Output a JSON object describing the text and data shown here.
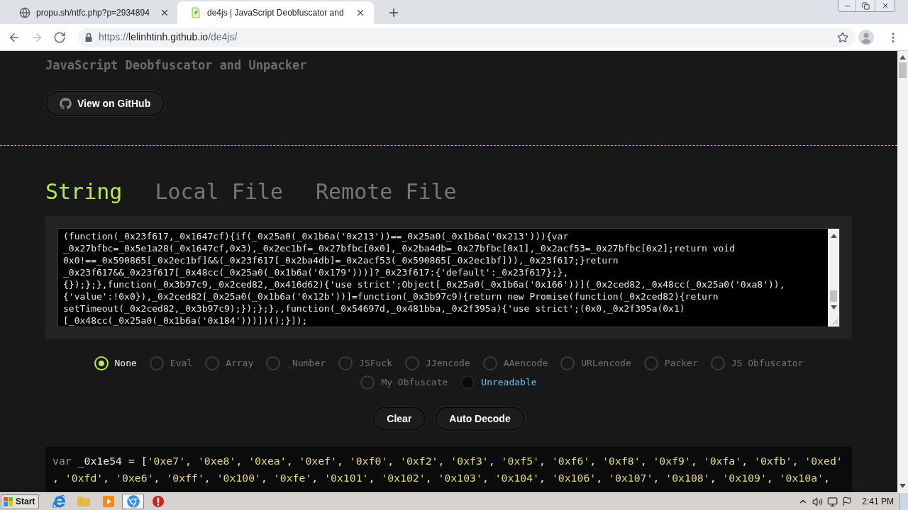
{
  "browser": {
    "tabs": [
      {
        "kind": "globe",
        "title": "propu.sh/ntfc.php?p=2934894",
        "selected": false
      },
      {
        "kind": "document",
        "title": "de4js | JavaScript Deobfuscator and",
        "selected": true
      }
    ],
    "nav": [
      {
        "kind": "back",
        "disabled": false
      },
      {
        "kind": "forward",
        "disabled": true
      },
      {
        "kind": "reload",
        "disabled": false
      }
    ],
    "address": {
      "scheme": "https://",
      "host": "lelinhtinh.github.io",
      "path": "/de4js/"
    }
  },
  "page": {
    "subtitle": "JavaScript Deobfuscator and Unpacker",
    "github_button": "View on GitHub",
    "tabs": [
      {
        "label": "String",
        "selected": true
      },
      {
        "label": "Local File",
        "selected": false
      },
      {
        "label": "Remote File",
        "selected": false
      }
    ],
    "input": {
      "lines": [
        "(function(_0x23f617,_0x1647cf){if(_0x25a0(_0x1b6a('0x213'))==_0x25a0(_0x1b6a('0x213'))){var",
        "_0x27bfbc=_0x5e1a28(_0x1647cf,0x3),_0x2ec1bf=_0x27bfbc[0x0],_0x2ba4db=_0x27bfbc[0x1],_0x2acf53=_0x27bfbc[0x2];return void",
        "0x0!==_0x590865[_0x2ec1bf]&&(_0x23f617[_0x2ba4db]=_0x2acf53(_0x590865[_0x2ec1bf])),_0x23f617;}return",
        "_0x23f617&&_0x23f617[_0x48cc(_0x25a0(_0x1b6a('0x179')))]?_0x23f617:{'default':_0x23f617};},",
        "{});};},function(_0x3b97c9,_0x2ced82,_0x416d62){'use strict';Object[_0x25a0(_0x1b6a('0x166'))](_0x2ced82,_0x48cc(_0x25a0('0xa8')),",
        "{'value':!0x0}),_0x2ced82[_0x25a0(_0x1b6a('0x12b'))]=function(_0x3b97c9){return new Promise(function(_0x2ced82){return",
        "setTimeout(_0x2ced82,_0x3b97c9);});};},,function(_0x54697d,_0x481bba,_0x2f395a){'use strict';(0x0,_0x2f395a(0x1)",
        "[_0x48cc(_0x25a0(_0x1b6a('0x184')))])();}]);"
      ]
    },
    "methods": [
      {
        "label": "None",
        "selected": true,
        "hovered": false
      },
      {
        "label": "Eval",
        "selected": false,
        "hovered": false
      },
      {
        "label": "Array",
        "selected": false,
        "hovered": false
      },
      {
        "label": "_Number",
        "selected": false,
        "hovered": false
      },
      {
        "label": "JSFuck",
        "selected": false,
        "hovered": false
      },
      {
        "label": "JJencode",
        "selected": false,
        "hovered": false
      },
      {
        "label": "AAencode",
        "selected": false,
        "hovered": false
      },
      {
        "label": "URLencode",
        "selected": false,
        "hovered": false
      },
      {
        "label": "Packer",
        "selected": false,
        "hovered": false
      },
      {
        "label": "JS Obfuscator",
        "selected": false,
        "hovered": false
      },
      {
        "label": "My Obfuscate",
        "selected": false,
        "hovered": false
      },
      {
        "label": "Unreadable",
        "selected": false,
        "hovered": true
      }
    ],
    "buttons": [
      "Clear",
      "Auto Decode"
    ],
    "output": {
      "lines": [
        [
          {
            "kind": "keyword",
            "text": "var"
          },
          {
            "kind": "plain",
            "text": " _0x1e54 = ["
          },
          {
            "kind": "string",
            "text": "'0xe7'"
          },
          {
            "kind": "plain",
            "text": ", "
          },
          {
            "kind": "string",
            "text": "'0xe8'"
          },
          {
            "kind": "plain",
            "text": ", "
          },
          {
            "kind": "string",
            "text": "'0xea'"
          },
          {
            "kind": "plain",
            "text": ", "
          },
          {
            "kind": "string",
            "text": "'0xef'"
          },
          {
            "kind": "plain",
            "text": ", "
          },
          {
            "kind": "string",
            "text": "'0xf0'"
          },
          {
            "kind": "plain",
            "text": ", "
          },
          {
            "kind": "string",
            "text": "'0xf2'"
          },
          {
            "kind": "plain",
            "text": ", "
          },
          {
            "kind": "string",
            "text": "'0xf3'"
          },
          {
            "kind": "plain",
            "text": ", "
          },
          {
            "kind": "string",
            "text": "'0xf5'"
          },
          {
            "kind": "plain",
            "text": ", "
          },
          {
            "kind": "string",
            "text": "'0xf6'"
          },
          {
            "kind": "plain",
            "text": ", "
          },
          {
            "kind": "string",
            "text": "'0xf8'"
          },
          {
            "kind": "plain",
            "text": ", "
          },
          {
            "kind": "string",
            "text": "'0xf9'"
          },
          {
            "kind": "plain",
            "text": ", "
          },
          {
            "kind": "string",
            "text": "'0xfa'"
          },
          {
            "kind": "plain",
            "text": ", "
          },
          {
            "kind": "string",
            "text": "'0xfb'"
          },
          {
            "kind": "plain",
            "text": ", "
          },
          {
            "kind": "string",
            "text": "'0xed'"
          }
        ],
        [
          {
            "kind": "plain",
            "text": ", "
          },
          {
            "kind": "string",
            "text": "'0xfd'"
          },
          {
            "kind": "plain",
            "text": ", "
          },
          {
            "kind": "string",
            "text": "'0xe6'"
          },
          {
            "kind": "plain",
            "text": ", "
          },
          {
            "kind": "string",
            "text": "'0xff'"
          },
          {
            "kind": "plain",
            "text": ", "
          },
          {
            "kind": "string",
            "text": "'0x100'"
          },
          {
            "kind": "plain",
            "text": ", "
          },
          {
            "kind": "string",
            "text": "'0xfe'"
          },
          {
            "kind": "plain",
            "text": ", "
          },
          {
            "kind": "string",
            "text": "'0x101'"
          },
          {
            "kind": "plain",
            "text": ", "
          },
          {
            "kind": "string",
            "text": "'0x102'"
          },
          {
            "kind": "plain",
            "text": ", "
          },
          {
            "kind": "string",
            "text": "'0x103'"
          },
          {
            "kind": "plain",
            "text": ", "
          },
          {
            "kind": "string",
            "text": "'0x104'"
          },
          {
            "kind": "plain",
            "text": ", "
          },
          {
            "kind": "string",
            "text": "'0x106'"
          },
          {
            "kind": "plain",
            "text": ", "
          },
          {
            "kind": "string",
            "text": "'0x107'"
          },
          {
            "kind": "plain",
            "text": ", "
          },
          {
            "kind": "string",
            "text": "'0x108'"
          },
          {
            "kind": "plain",
            "text": ", "
          },
          {
            "kind": "string",
            "text": "'0x109'"
          },
          {
            "kind": "plain",
            "text": ", "
          },
          {
            "kind": "string",
            "text": "'0x10a'"
          },
          {
            "kind": "plain",
            "text": ","
          }
        ]
      ]
    }
  },
  "taskbar": {
    "start": "Start",
    "apps": [
      {
        "kind": "ie",
        "selected": false
      },
      {
        "kind": "folder",
        "selected": false
      },
      {
        "kind": "media",
        "selected": false
      },
      {
        "kind": "chrome",
        "selected": true
      },
      {
        "kind": "alert",
        "selected": false
      }
    ],
    "clock": "2:41 PM"
  }
}
